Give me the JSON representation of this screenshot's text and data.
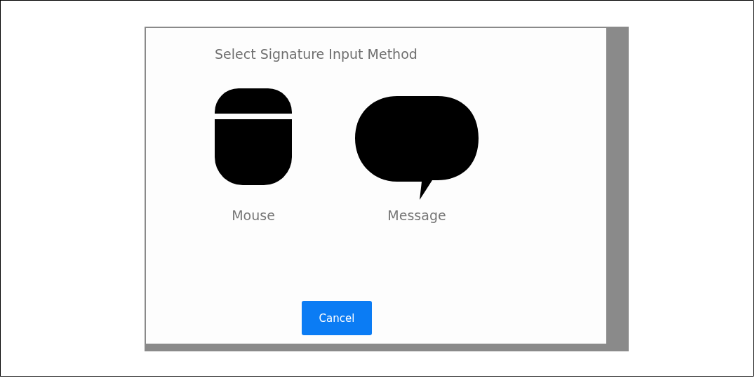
{
  "dialog": {
    "title": "Select Signature Input Method",
    "options": [
      {
        "kind": "mouse",
        "label": "Mouse"
      },
      {
        "kind": "message",
        "label": "Message"
      }
    ],
    "buttons": [
      {
        "label": "Cancel"
      }
    ]
  }
}
